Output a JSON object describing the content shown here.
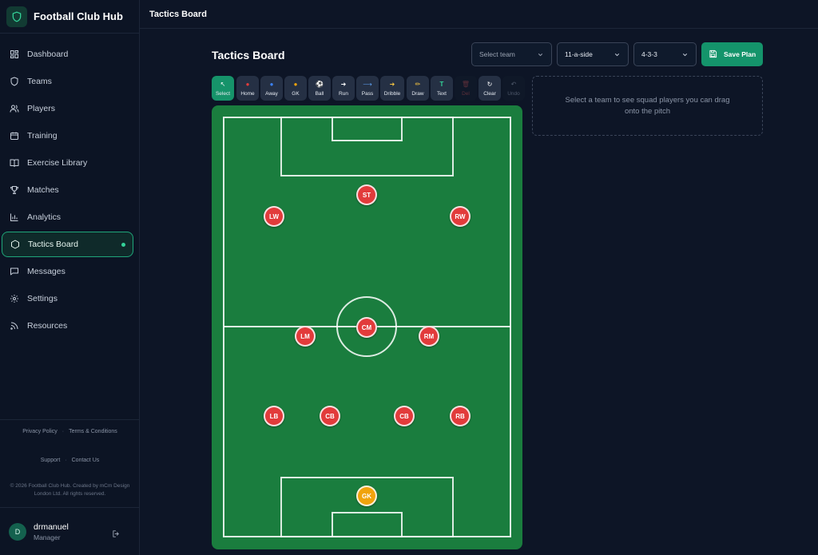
{
  "app": {
    "name": "Football Club Hub"
  },
  "sidebar": {
    "items": [
      {
        "label": "Dashboard",
        "icon": "dashboard-icon"
      },
      {
        "label": "Teams",
        "icon": "shield-icon"
      },
      {
        "label": "Players",
        "icon": "users-icon"
      },
      {
        "label": "Training",
        "icon": "calendar-icon"
      },
      {
        "label": "Exercise Library",
        "icon": "book-icon"
      },
      {
        "label": "Matches",
        "icon": "trophy-icon"
      },
      {
        "label": "Analytics",
        "icon": "bar-chart-icon"
      },
      {
        "label": "Tactics Board",
        "icon": "hexagon-icon",
        "active": true
      },
      {
        "label": "Messages",
        "icon": "message-icon"
      },
      {
        "label": "Settings",
        "icon": "gear-icon"
      },
      {
        "label": "Resources",
        "icon": "rss-icon"
      }
    ],
    "footer": {
      "privacy": "Privacy Policy",
      "terms": "Terms & Conditions",
      "support": "Support",
      "contact": "Contact Us",
      "sep": "·",
      "copyright": "© 2026 Football Club Hub. Created by mCm Design London Ltd. All rights reserved."
    },
    "user": {
      "initial": "D",
      "name": "drmanuel",
      "role": "Manager"
    }
  },
  "topbar": {
    "title": "Tactics Board"
  },
  "main": {
    "title": "Tactics Board",
    "team_select": {
      "value": "Select team"
    },
    "format_select": {
      "value": "11-a-side"
    },
    "formation_select": {
      "value": "4-3-3"
    },
    "save_label": "Save Plan",
    "squad_hint": "Select a team to see squad players you can drag onto the pitch"
  },
  "toolbar": {
    "tools": [
      {
        "label": "Select",
        "glyph": "↖"
      },
      {
        "label": "Home",
        "glyph": "●"
      },
      {
        "label": "Away",
        "glyph": "●"
      },
      {
        "label": "GK",
        "glyph": "●"
      },
      {
        "label": "Ball",
        "glyph": "⚽"
      },
      {
        "label": "Run",
        "glyph": "➜"
      },
      {
        "label": "Pass",
        "glyph": "⟶"
      },
      {
        "label": "Dribble",
        "glyph": "➜"
      },
      {
        "label": "Draw",
        "glyph": "✏"
      },
      {
        "label": "Text",
        "glyph": "T"
      },
      {
        "label": "Del",
        "glyph": "🗑"
      },
      {
        "label": "Clear",
        "glyph": "↻"
      },
      {
        "label": "Undo",
        "glyph": "↶"
      }
    ]
  },
  "colors": {
    "accent": "#16936a",
    "home": "#e23b3b",
    "goalkeeper": "#f0a30c",
    "pitch": "#1a7d3e"
  },
  "pitch": {
    "players": [
      {
        "label": "ST"
      },
      {
        "label": "LW"
      },
      {
        "label": "RW"
      },
      {
        "label": "CM"
      },
      {
        "label": "LM"
      },
      {
        "label": "RM"
      },
      {
        "label": "LB"
      },
      {
        "label": "CB"
      },
      {
        "label": "CB"
      },
      {
        "label": "RB"
      },
      {
        "label": "GK"
      }
    ]
  }
}
